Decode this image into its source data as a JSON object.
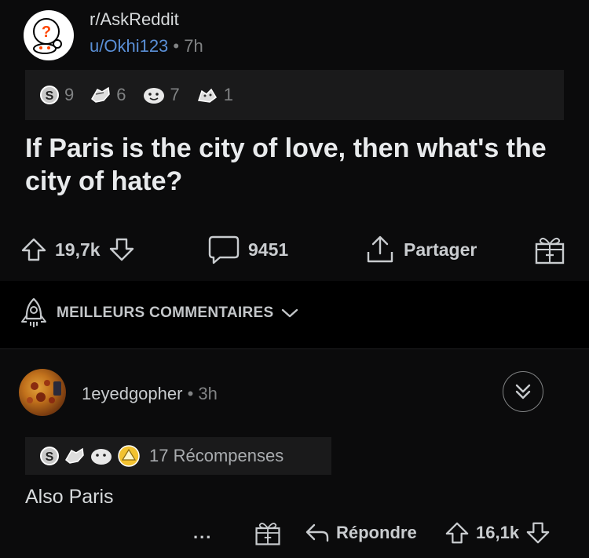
{
  "post": {
    "subreddit": "r/AskReddit",
    "author": "u/Okhi123",
    "separator": "•",
    "age": "7h",
    "awards": [
      {
        "icon": "silver-award-icon",
        "count": "9"
      },
      {
        "icon": "helpful-award-icon",
        "count": "6"
      },
      {
        "icon": "wholesome-award-icon",
        "count": "7"
      },
      {
        "icon": "hugz-award-icon",
        "count": "1"
      }
    ],
    "title": "If Paris is the city of love, then what's the city of hate?",
    "score": "19,7k",
    "comments": "9451",
    "share_label": "Partager"
  },
  "sort": {
    "label": "MEILLEURS COMMENTAIRES"
  },
  "comment": {
    "author": "1eyedgopher",
    "separator": "•",
    "age": "3h",
    "awards_label": "17 Récompenses",
    "body": "Also Paris",
    "more_label": "...",
    "reply_label": "Répondre",
    "score": "16,1k"
  },
  "colors": {
    "background": "#000000",
    "card": "#0b0b0c",
    "award_bar": "#1a1a1b",
    "user_link": "#5a8fd6",
    "muted": "#818384"
  }
}
